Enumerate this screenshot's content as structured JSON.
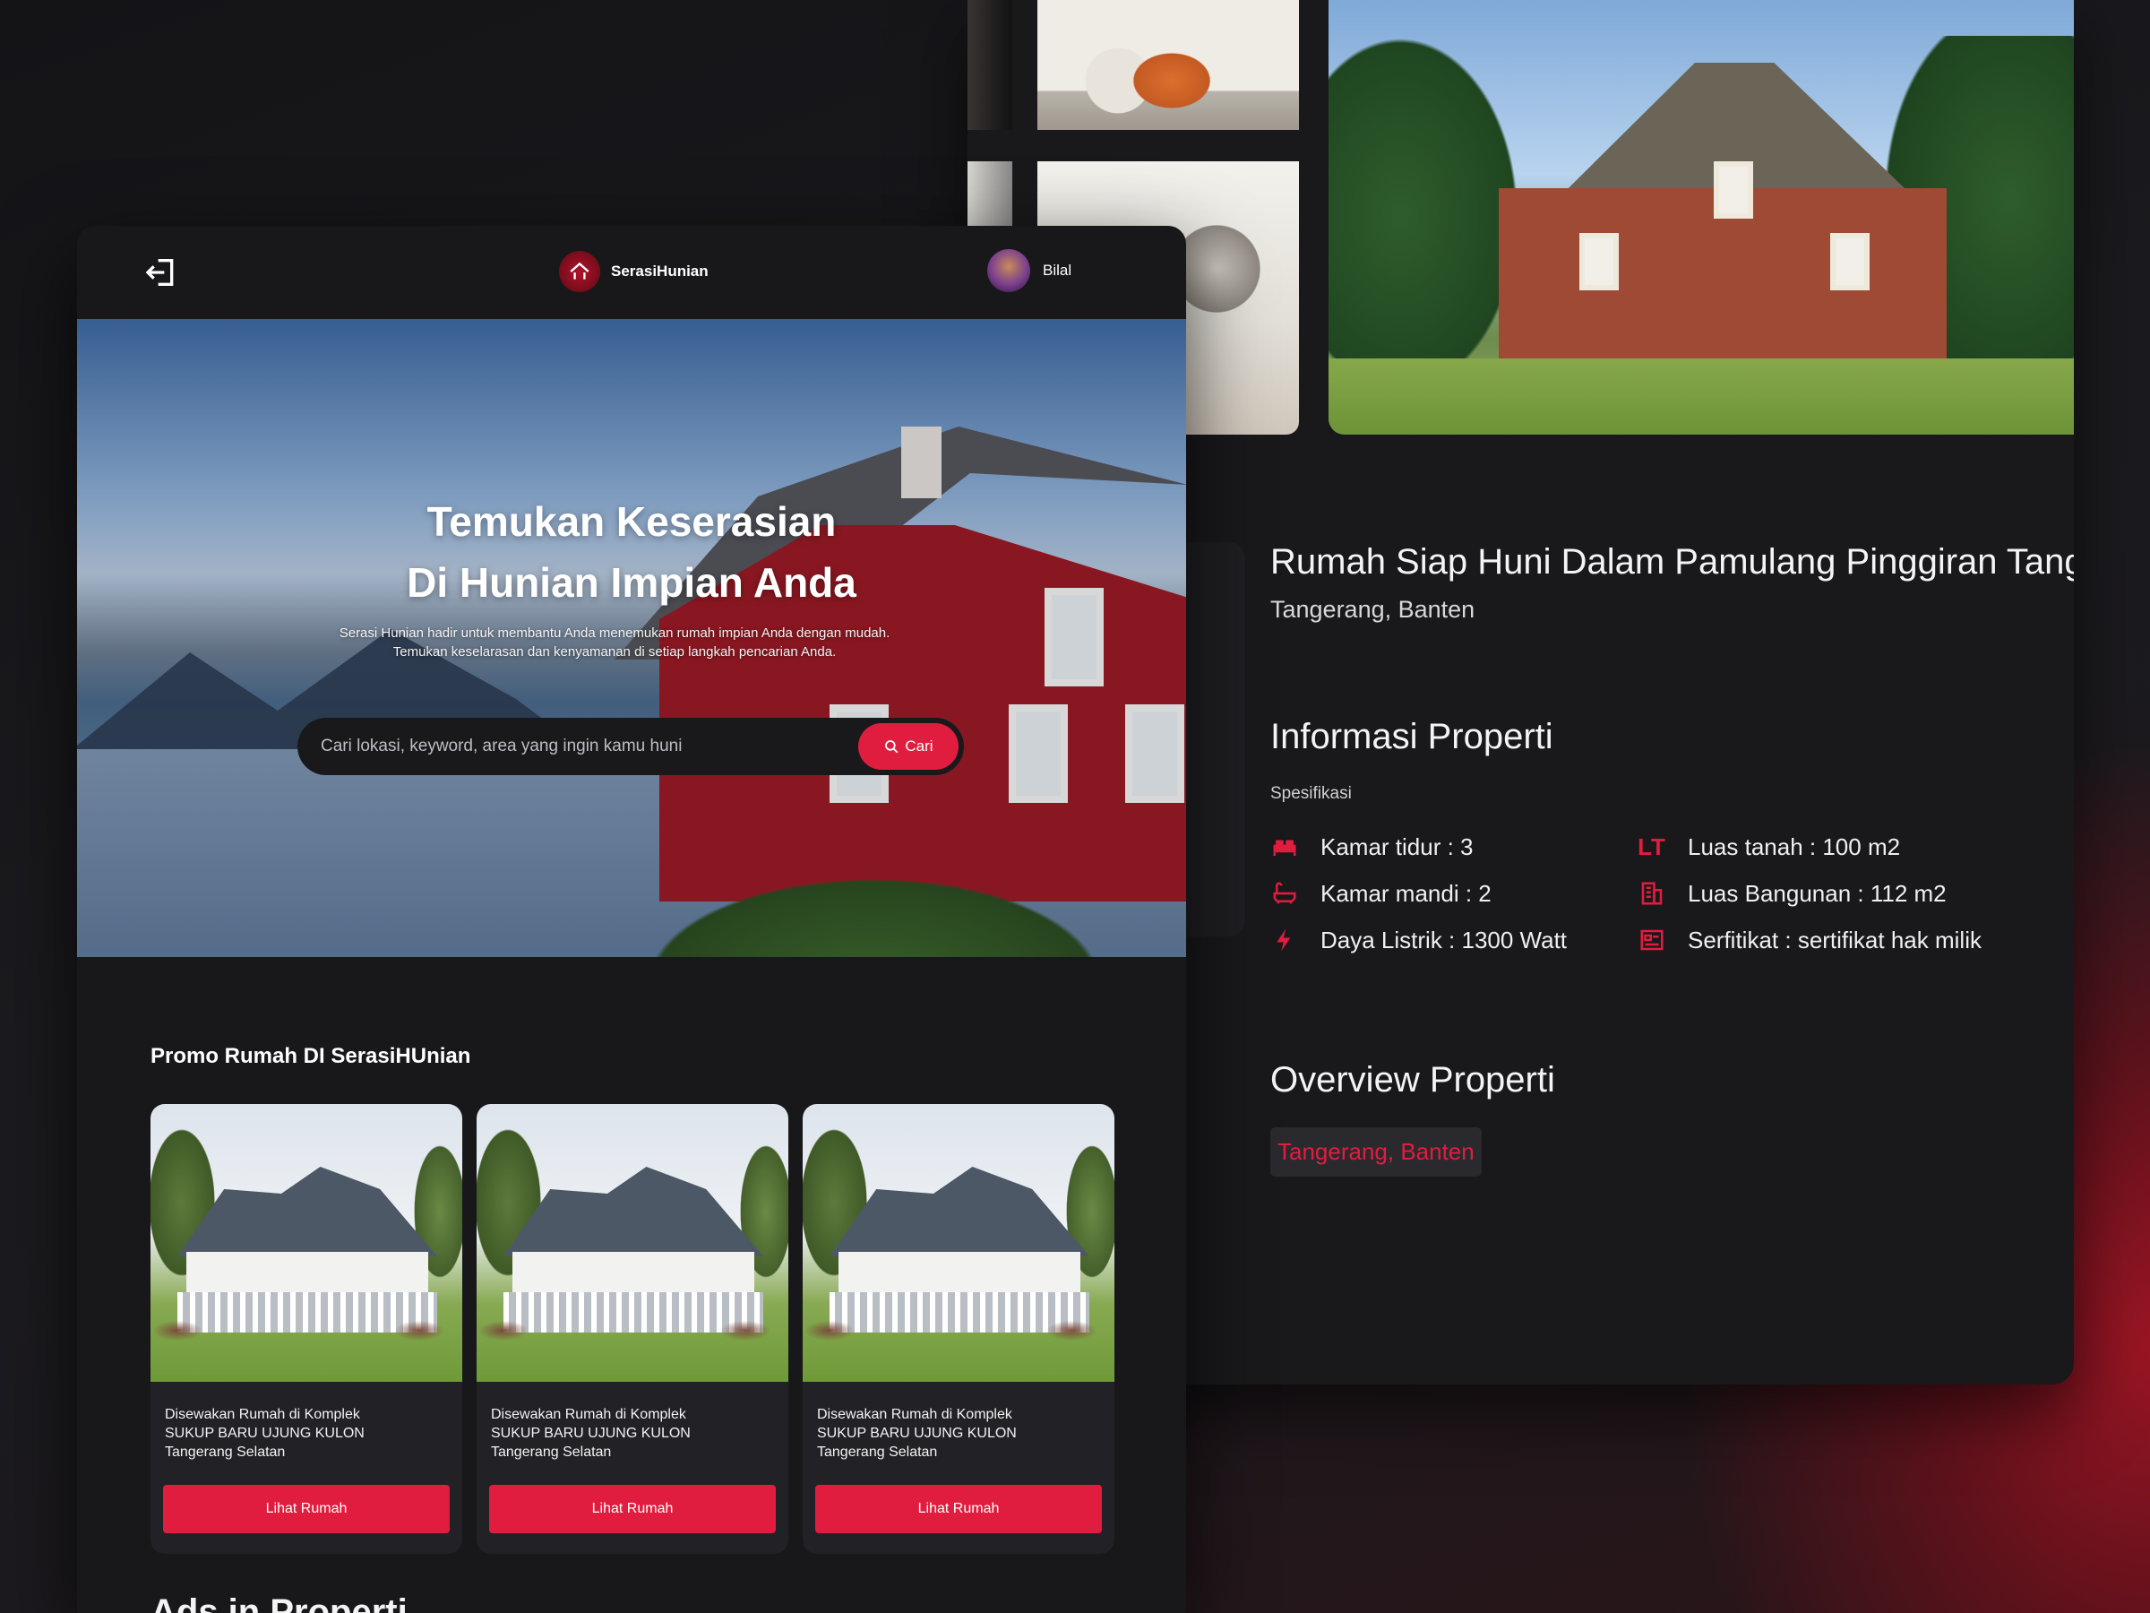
{
  "home": {
    "nav": {
      "brand_name": "SerasiHunian",
      "user_name": "Bilal"
    },
    "hero": {
      "title_line1": "Temukan Keserasian",
      "title_line2": "Di Hunian Impian Anda",
      "subtitle_line1": "Serasi Hunian hadir untuk membantu Anda menemukan rumah impian Anda dengan mudah.",
      "subtitle_line2": "Temukan keselarasan dan kenyamanan di setiap langkah pencarian Anda.",
      "search_placeholder": "Cari lokasi, keyword, area yang ingin kamu huni",
      "search_button": "Cari"
    },
    "promo": {
      "title": "Promo Rumah DI SerasiHUnian",
      "cards": [
        {
          "line1": "Disewakan Rumah di Komplek",
          "line2": "SUKUP BARU UJUNG KULON",
          "line3": "Tangerang Selatan",
          "button": "Lihat Rumah"
        },
        {
          "line1": "Disewakan Rumah di Komplek",
          "line2": "SUKUP BARU UJUNG KULON",
          "line3": "Tangerang Selatan",
          "button": "Lihat Rumah"
        },
        {
          "line1": "Disewakan Rumah di Komplek",
          "line2": "SUKUP BARU UJUNG KULON",
          "line3": "Tangerang Selatan",
          "button": "Lihat Rumah"
        }
      ]
    },
    "next_section_title": "Ads in Properti"
  },
  "detail": {
    "title": "Rumah Siap Huni Dalam Pamulang Pinggiran Tang",
    "location": "Tangerang, Banten",
    "info_heading": "Informasi Properti",
    "spec_label": "Spesifikasi",
    "specs": [
      {
        "icon": "bed-icon",
        "text": "Kamar tidur : 3"
      },
      {
        "icon": "land-area-icon",
        "icon_text": "LT",
        "text": "Luas tanah : 100 m2"
      },
      {
        "icon": "bathtub-icon",
        "text": "Kamar mandi : 2"
      },
      {
        "icon": "building-icon",
        "text": "Luas Bangunan : 112 m2"
      },
      {
        "icon": "lightning-icon",
        "text": "Daya Listrik : 1300 Watt"
      },
      {
        "icon": "certificate-icon",
        "text": "Serfitikat : sertifikat hak milik"
      }
    ],
    "overview_heading": "Overview Properti",
    "overview_tag": "Tangerang, Banten"
  },
  "colors": {
    "accent": "#e11d3f",
    "panel": "#18181b",
    "card": "#222226"
  }
}
